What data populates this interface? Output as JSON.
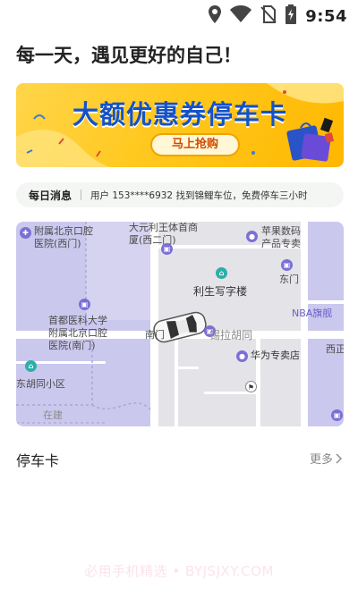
{
  "status_bar": {
    "time": "9:54",
    "icons": [
      "location-icon",
      "wifi-icon",
      "no-sim-icon",
      "battery-charging-icon"
    ]
  },
  "greeting": "每一天，遇见更好的自己！",
  "banner": {
    "title": "大额优惠券停车卡",
    "button_label": "马上抢购"
  },
  "notice": {
    "label": "每日消息",
    "message": "用户 153****6932 找到锦鲤车位，免费停车三小时"
  },
  "map": {
    "labels": [
      {
        "id": "hospital-west",
        "text": "附属北京口腔\n医院(西门)"
      },
      {
        "id": "building-top",
        "text": "大元利王体首商\n厦(西二门)"
      },
      {
        "id": "apple-store",
        "text": "苹果数码\n产品专卖"
      },
      {
        "id": "east-gate",
        "text": "东门"
      },
      {
        "id": "lisheng",
        "text": "利生写字楼"
      },
      {
        "id": "hospital-south",
        "text": "首都医科大学\n附属北京口腔\n医院(南门)"
      },
      {
        "id": "nba",
        "text": "NBA旗舰"
      },
      {
        "id": "xilahutong",
        "text": "锡拉胡同"
      },
      {
        "id": "south-gate-partial",
        "text": "南门"
      },
      {
        "id": "west-partial",
        "text": "西正"
      },
      {
        "id": "huawei",
        "text": "华为专卖店"
      },
      {
        "id": "community",
        "text": "东胡同小区"
      },
      {
        "id": "construction",
        "text": "在建"
      }
    ]
  },
  "parking_section": {
    "title": "停车卡",
    "more_label": "更多"
  },
  "watermark": "必用手机精选 • BYJSJXY.COM"
}
